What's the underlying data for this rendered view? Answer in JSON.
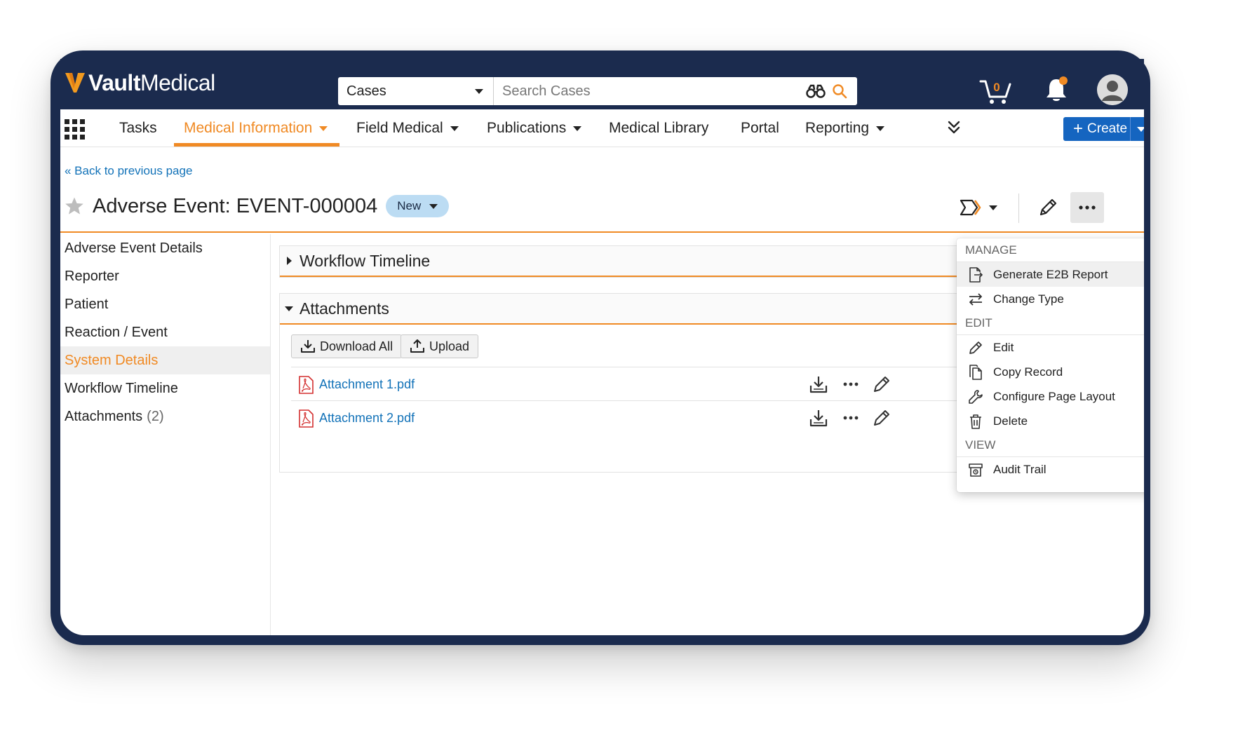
{
  "app": {
    "logo_bold": "Vault",
    "logo_light": "Medical"
  },
  "search": {
    "scope": "Cases",
    "placeholder": "Search Cases"
  },
  "header": {
    "cart_count": "0"
  },
  "nav": {
    "items": [
      {
        "label": "Tasks"
      },
      {
        "label": "Medical Information"
      },
      {
        "label": "Field Medical"
      },
      {
        "label": "Publications"
      },
      {
        "label": "Medical Library"
      },
      {
        "label": "Portal"
      },
      {
        "label": "Reporting"
      }
    ],
    "create_label": "Create"
  },
  "page": {
    "back_link": "« Back to previous page",
    "title": "Adverse Event: EVENT-000004",
    "status": "New"
  },
  "left_nav": {
    "items": [
      {
        "label": "Adverse Event Details"
      },
      {
        "label": "Reporter"
      },
      {
        "label": "Patient"
      },
      {
        "label": "Reaction / Event"
      },
      {
        "label": "System Details"
      },
      {
        "label": "Workflow Timeline"
      },
      {
        "label": "Attachments",
        "count": "(2)"
      }
    ]
  },
  "sections": {
    "workflow": {
      "title": "Workflow Timeline"
    },
    "attachments": {
      "title": "Attachments",
      "download_all": "Download All",
      "upload": "Upload",
      "files": [
        "Attachment 1.pdf",
        "Attachment 2.pdf"
      ]
    }
  },
  "menu": {
    "manage_header": "MANAGE",
    "generate_e2b": "Generate E2B Report",
    "change_type": "Change Type",
    "edit_header": "EDIT",
    "edit": "Edit",
    "copy_record": "Copy Record",
    "configure_layout": "Configure Page Layout",
    "delete": "Delete",
    "view_header": "VIEW",
    "audit_trail": "Audit Trail"
  },
  "colors": {
    "brand_navy": "#1b2b4e",
    "accent_orange": "#f08a24",
    "link_blue": "#1272b8",
    "create_blue": "#1565c0",
    "status_badge": "#bcdcf3"
  },
  "icons": [
    "vault-logo-icon",
    "binoculars-icon",
    "search-icon",
    "cart-icon",
    "bell-icon",
    "avatar-icon",
    "app-grid-icon",
    "chevron-double-down-icon",
    "star-icon",
    "workflow-icon",
    "pencil-icon",
    "more-icon",
    "download-icon",
    "upload-icon",
    "pdf-icon",
    "export-icon",
    "swap-icon",
    "copy-icon",
    "wrench-icon",
    "trash-icon",
    "audit-icon"
  ]
}
